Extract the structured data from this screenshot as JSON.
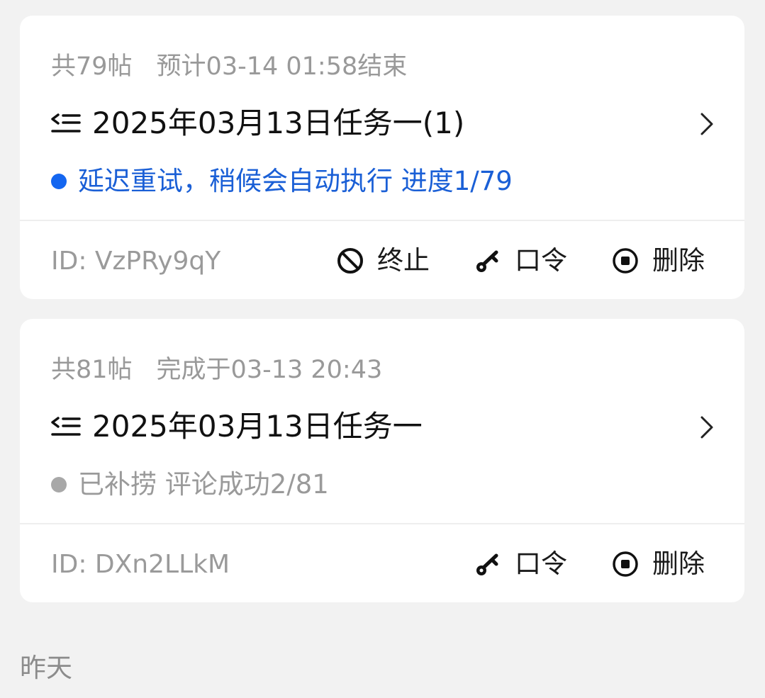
{
  "tasks": [
    {
      "count_label": "共79帖",
      "time_label": "预计03-14 01:58结束",
      "title": "2025年03月13日任务一(1)",
      "status_text": "延迟重试，稍候会自动执行 进度1/79",
      "status_color": "#1a5fd6",
      "status_dot_color": "#1466f0",
      "id_label": "ID: VzPRy9qY",
      "actions": {
        "terminate": "终止",
        "password": "口令",
        "delete": "删除"
      }
    },
    {
      "count_label": "共81帖",
      "time_label": "完成于03-13 20:43",
      "title": "2025年03月13日任务一",
      "status_text": "已补捞 评论成功2/81",
      "status_color": "#9a9a9a",
      "status_dot_color": "#a8a8a8",
      "id_label": "ID: DXn2LLkM",
      "actions": {
        "password": "口令",
        "delete": "删除"
      }
    }
  ],
  "section_label": "昨天",
  "icons": {
    "list": "list-indent-icon",
    "chevron": "chevron-right-icon",
    "terminate": "ban-icon",
    "password": "key-icon",
    "delete": "stop-circle-icon"
  }
}
